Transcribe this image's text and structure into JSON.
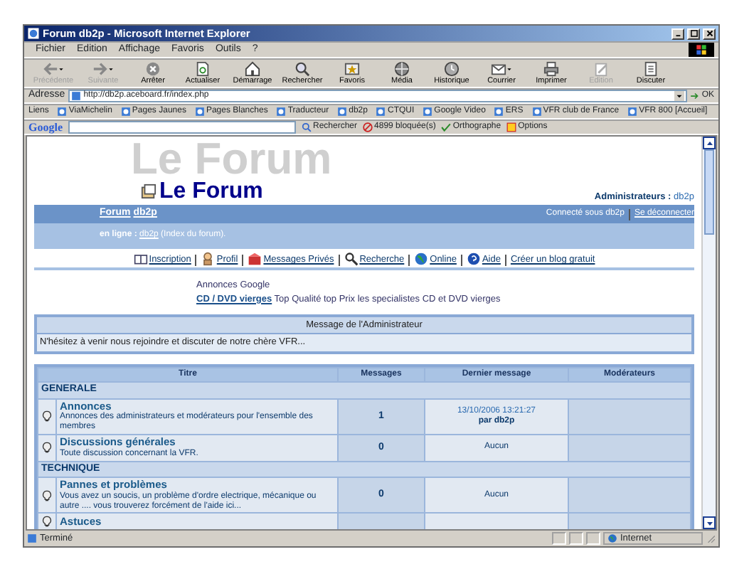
{
  "window": {
    "title": "Forum db2p - Microsoft Internet Explorer"
  },
  "menu": [
    {
      "label": "Fichier"
    },
    {
      "label": "Edition"
    },
    {
      "label": "Affichage"
    },
    {
      "label": "Favoris"
    },
    {
      "label": "Outils"
    },
    {
      "label": "?"
    }
  ],
  "toolbar": [
    {
      "label": "Précédente",
      "disabled": true,
      "dropdown": true
    },
    {
      "label": "Suivante",
      "disabled": true,
      "dropdown": true
    },
    {
      "label": "Arrêter",
      "disabled": false,
      "dropdown": false
    },
    {
      "label": "Actualiser",
      "disabled": false,
      "dropdown": false
    },
    {
      "label": "Démarrage",
      "disabled": false,
      "dropdown": false
    },
    {
      "label": "Rechercher",
      "disabled": false,
      "dropdown": false
    },
    {
      "label": "Favoris",
      "disabled": false,
      "dropdown": false
    },
    {
      "label": "Média",
      "disabled": false,
      "dropdown": false
    },
    {
      "label": "Historique",
      "disabled": false,
      "dropdown": false
    },
    {
      "label": "Courrier",
      "disabled": false,
      "dropdown": true
    },
    {
      "label": "Imprimer",
      "disabled": false,
      "dropdown": false
    },
    {
      "label": "Edition",
      "disabled": true,
      "dropdown": false
    },
    {
      "label": "Discuter",
      "disabled": false,
      "dropdown": false
    }
  ],
  "address": {
    "label": "Adresse",
    "value": "http://db2p.aceboard.fr/index.php",
    "go": "OK"
  },
  "links": {
    "label": "Liens",
    "items": [
      {
        "label": "ViaMichelin"
      },
      {
        "label": "Pages Jaunes"
      },
      {
        "label": "Pages Blanches"
      },
      {
        "label": "Traducteur"
      },
      {
        "label": "db2p"
      },
      {
        "label": "CTQUI"
      },
      {
        "label": "Google Video"
      },
      {
        "label": "ERS"
      },
      {
        "label": "VFR club de France"
      },
      {
        "label": "VFR 800 [Accueil]"
      }
    ]
  },
  "google": {
    "logo": "Google",
    "search": "Rechercher",
    "blocked": "4899 bloquée(s)",
    "spell": "Orthographe",
    "options": "Options"
  },
  "page": {
    "watermark": "Le Forum",
    "title": "Le Forum",
    "admins_label": "Administrateurs :",
    "admin": "db2p",
    "nav": {
      "forum": "Forum",
      "name": "db2p",
      "connected": "Connecté sous db2p",
      "logout": "Se déconnecter"
    },
    "online": {
      "label": "en ligne :",
      "user": "db2p",
      "rest": "(Index du forum)."
    },
    "menu": [
      {
        "label": "Inscription"
      },
      {
        "label": "Profil"
      },
      {
        "label": "Messages Privés"
      },
      {
        "label": "Recherche"
      },
      {
        "label": "Online"
      },
      {
        "label": "Aide"
      },
      {
        "label": "Créer un blog gratuit"
      }
    ],
    "ads": {
      "heading": "Annonces Google",
      "link": "CD / DVD vierges",
      "text": "Top Qualité top Prix les specialistes CD et DVD vierges"
    },
    "admin_message": {
      "title": "Message de l'Administrateur",
      "text": "N'hésitez à venir nous rejoindre et discuter de notre chère VFR..."
    },
    "table": {
      "columns": [
        "Titre",
        "Messages",
        "Dernier message",
        "Modérateurs"
      ],
      "sections": [
        {
          "name": "GENERALE",
          "forums": [
            {
              "title": "Annonces",
              "description": "Annonces des administrateurs et modérateurs pour l'ensemble des membres",
              "messages": "1",
              "last_message": {
                "date": "13/10/2006 13:21:27",
                "by": "par db2p"
              }
            },
            {
              "title": "Discussions générales",
              "description": "Toute discussion concernant la VFR.",
              "messages": "0",
              "last_message": "Aucun"
            }
          ]
        },
        {
          "name": "TECHNIQUE",
          "forums": [
            {
              "title": "Pannes et problèmes",
              "description": "Vous avez un soucis, un problème d'ordre electrique, mécanique ou autre .... vous trouverez forcément de l'aide ici...",
              "messages": "0",
              "last_message": "Aucun"
            },
            {
              "title": "Astuces"
            }
          ]
        }
      ]
    }
  },
  "status_bar": {
    "text": "Terminé",
    "zone": "Internet"
  }
}
